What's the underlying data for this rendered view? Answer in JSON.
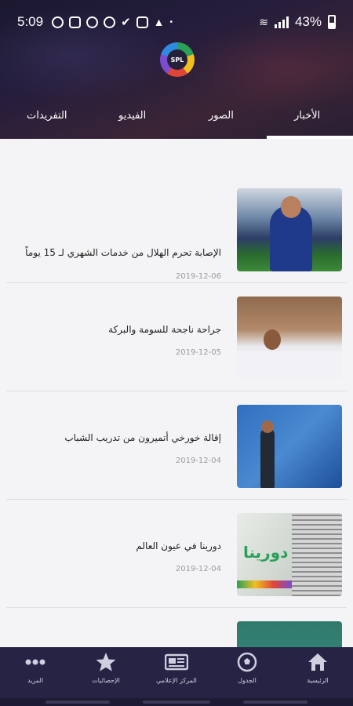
{
  "status_bar": {
    "time": "5:09",
    "battery": "43%"
  },
  "app": {
    "logo_text": "SPL"
  },
  "tabs": [
    {
      "label": "الأخبار",
      "active": true
    },
    {
      "label": "الصور"
    },
    {
      "label": "الفيديو"
    },
    {
      "label": "التفريدات"
    }
  ],
  "news": [
    {
      "title": "الإصابة تحرم الهلال من خدمات الشهري لـ 15 يوماً",
      "date": "2019-12-06"
    },
    {
      "title": "جراحة ناجحة للسومة والبركة",
      "date": "2019-12-05"
    },
    {
      "title": "إقالة خورخي أتميرون من تدريب الشباب",
      "date": "2019-12-04"
    },
    {
      "title": "دورينا في عيون العالم",
      "date": "2019-12-04",
      "thumb_text": "دورينا"
    }
  ],
  "bottom_nav": [
    {
      "label": "الرئيسية",
      "icon": "home-icon"
    },
    {
      "label": "الجدول",
      "icon": "ball-icon"
    },
    {
      "label": "المركز الإعلامي",
      "icon": "newspaper-icon"
    },
    {
      "label": "الإحصائيات",
      "icon": "star-icon"
    },
    {
      "label": "المزيد",
      "icon": "more-icon"
    }
  ],
  "colors": {
    "header": "#231d38",
    "nav": "#262345",
    "background": "#f4f4f6"
  }
}
